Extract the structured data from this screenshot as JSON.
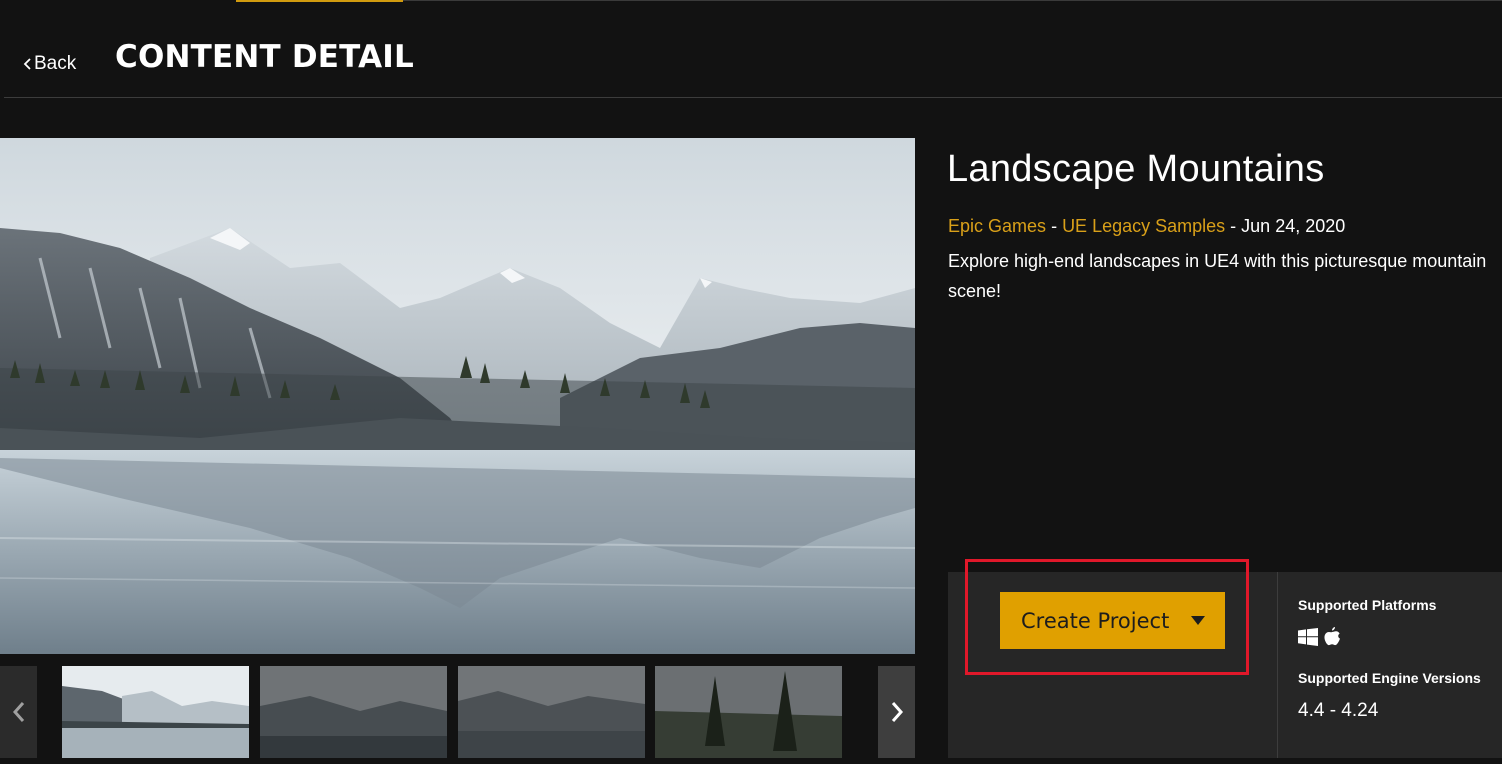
{
  "header": {
    "back_label": "Back",
    "title": "CONTENT DETAIL"
  },
  "asset": {
    "title": "Landscape Mountains",
    "publisher": "Epic Games",
    "category": "UE Legacy Samples",
    "separator": "-",
    "date": "Jun 24, 2020",
    "description": "Explore high-end landscapes in UE4 with this picturesque mountain scene!"
  },
  "actions": {
    "create_label": "Create Project"
  },
  "specs": {
    "platforms_label": "Supported Platforms",
    "platforms": [
      "windows-icon",
      "apple-icon"
    ],
    "versions_label": "Supported Engine Versions",
    "versions": "4.4 - 4.24"
  },
  "gallery": {
    "thumbnails": 4,
    "selected_index": 0
  },
  "colors": {
    "accent": "#e0a000",
    "link": "#d9a019",
    "background": "#121212",
    "panel": "#262626",
    "highlight": "#e0182a"
  }
}
